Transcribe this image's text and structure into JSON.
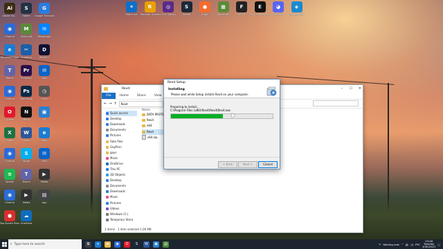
{
  "desktop": {
    "left_icons": [
      {
        "label": "Adobe Illu...",
        "color": "#3b2c12",
        "glyph": "Ai",
        "icon": "illustrator-icon"
      },
      {
        "label": "Chrome",
        "color": "#2b6bd6",
        "glyph": "◉",
        "icon": "chrome-icon"
      },
      {
        "label": "Microsoft Edge",
        "color": "#1b7bd4",
        "glyph": "e",
        "icon": "edge-icon"
      },
      {
        "label": "Teams",
        "color": "#6264a7",
        "glyph": "T",
        "icon": "teams-icon"
      },
      {
        "label": "Chrome",
        "color": "#2b6bd6",
        "glyph": "◉",
        "icon": "chrome-icon"
      },
      {
        "label": "Opera",
        "color": "#e0192c",
        "glyph": "O",
        "icon": "opera-icon"
      },
      {
        "label": "Excel",
        "color": "#1e7145",
        "glyph": "X",
        "icon": "excel-icon"
      },
      {
        "label": "Chrome",
        "color": "#2b6bd6",
        "glyph": "◉",
        "icon": "chrome-icon"
      },
      {
        "label": "Spotify",
        "color": "#1db954",
        "glyph": "≋",
        "icon": "spotify-icon"
      },
      {
        "label": "Chrome",
        "color": "#2b6bd6",
        "glyph": "◉",
        "icon": "chrome-icon"
      },
      {
        "label": "Top Screen Recorder",
        "color": "#d83030",
        "glyph": "●",
        "icon": "recorder-icon"
      }
    ],
    "col2_icons": [
      {
        "label": "Steam",
        "color": "#234",
        "glyph": "S",
        "icon": "steam-icon"
      },
      {
        "label": "Minecraft",
        "color": "#5a8a3a",
        "glyph": "M",
        "icon": "minecraft-icon"
      },
      {
        "label": "Snipping",
        "color": "#1a5fa8",
        "glyph": "✂",
        "icon": "snip-icon"
      },
      {
        "label": "Premiere",
        "color": "#2a0f4a",
        "glyph": "Pr",
        "icon": "premiere-icon"
      },
      {
        "label": "Photoshop",
        "color": "#0a2a45",
        "glyph": "Ps",
        "icon": "photoshop-icon"
      },
      {
        "label": "Netflix",
        "color": "#111",
        "glyph": "N",
        "icon": "netflix-icon"
      },
      {
        "label": "Word",
        "color": "#2b579a",
        "glyph": "W",
        "icon": "word-icon"
      },
      {
        "label": "Skype",
        "color": "#00aff0",
        "glyph": "S",
        "icon": "skype-icon"
      },
      {
        "label": "Teams",
        "color": "#6264a7",
        "glyph": "T",
        "icon": "teams-icon"
      },
      {
        "label": "Media",
        "color": "#333",
        "glyph": "▶",
        "icon": "media-icon"
      },
      {
        "label": "OneDrive",
        "color": "#0f6cbd",
        "glyph": "☁",
        "icon": "onedrive-icon"
      }
    ],
    "col3_icons": [
      {
        "label": "Google Translate",
        "color": "#2a7de1",
        "glyph": "G",
        "icon": "translate-icon"
      },
      {
        "label": "Messenger",
        "color": "#0084ff",
        "glyph": "✉",
        "icon": "messenger-icon"
      },
      {
        "label": "Disney+",
        "color": "#113",
        "glyph": "D",
        "icon": "disney-icon"
      },
      {
        "label": "Mail",
        "color": "#0a64c8",
        "glyph": "✉",
        "icon": "mail-icon"
      },
      {
        "label": "Clock",
        "color": "#555",
        "glyph": "◷",
        "icon": "clock-icon"
      },
      {
        "label": "3D",
        "color": "#2a80d0",
        "glyph": "▣",
        "icon": "3d-icon"
      },
      {
        "label": "Edge",
        "color": "#1b7bd4",
        "glyph": "e",
        "icon": "edge-icon"
      },
      {
        "label": "Mail",
        "color": "#0a64c8",
        "glyph": "✉",
        "icon": "mail-icon"
      },
      {
        "label": "Media",
        "color": "#333",
        "glyph": "▶",
        "icon": "media-icon"
      },
      {
        "label": "App",
        "color": "#444",
        "glyph": "▤",
        "icon": "app-icon"
      }
    ],
    "top_icons": [
      {
        "label": "Battle.net",
        "color": "#0e6fc8",
        "glyph": "✶",
        "icon": "battlenet-icon"
      },
      {
        "label": "Rockstar Games",
        "color": "#e8a000",
        "glyph": "R",
        "icon": "rockstar-icon"
      },
      {
        "label": "GOG Galaxy",
        "color": "#5a2a8a",
        "glyph": "◎",
        "icon": "gog-icon"
      },
      {
        "label": "Steam",
        "color": "#1b2838",
        "glyph": "S",
        "icon": "steam-icon"
      },
      {
        "label": "Origin",
        "color": "#f56c2d",
        "glyph": "●",
        "icon": "origin-icon"
      },
      {
        "label": "Minecraft",
        "color": "#5a8a3a",
        "glyph": "▦",
        "icon": "minecraft-icon"
      },
      {
        "label": "FACEIT",
        "color": "#222",
        "glyph": "F",
        "icon": "faceit-icon"
      },
      {
        "label": "Epic Games Launcher",
        "color": "#111",
        "glyph": "E",
        "icon": "epic-icon"
      },
      {
        "label": "Discord",
        "color": "#5865f2",
        "glyph": "◕",
        "icon": "discord-icon"
      },
      {
        "label": "GameGuard",
        "color": "#1a8ad0",
        "glyph": "◈",
        "icon": "gameguard-icon"
      }
    ]
  },
  "explorer": {
    "title": "Revit",
    "ribbon": [
      "File",
      "Home",
      "Share",
      "View",
      "Application Tools"
    ],
    "address": "Revit",
    "column_header": "Name",
    "nav_items": [
      {
        "label": "Quick access",
        "color": "#2c7be5",
        "sel": true
      },
      {
        "label": "Desktop",
        "color": "#2c7be5"
      },
      {
        "label": "Downloads",
        "color": "#2c7be5"
      },
      {
        "label": "Documents",
        "color": "#888"
      },
      {
        "label": "Pictures",
        "color": "#2c7be5"
      },
      {
        "label": "Fake files",
        "color": "#e8b94a"
      },
      {
        "label": "GayPorn",
        "color": "#e8b94a"
      },
      {
        "label": "gays",
        "color": "#e8b94a"
      },
      {
        "label": "Music",
        "color": "#e8508a"
      },
      {
        "label": "OneDrive",
        "color": "#0f6cbd"
      },
      {
        "label": "This PC",
        "color": "#2c7be5"
      },
      {
        "label": "3D Objects",
        "color": "#2c9ce5"
      },
      {
        "label": "Desktop",
        "color": "#2c7be5"
      },
      {
        "label": "Documents",
        "color": "#888"
      },
      {
        "label": "Downloads",
        "color": "#2c7be5"
      },
      {
        "label": "Music",
        "color": "#e8508a"
      },
      {
        "label": "Pictures",
        "color": "#2c7be5"
      },
      {
        "label": "Videos",
        "color": "#7a4fcf"
      },
      {
        "label": "Windows (C:)",
        "color": "#777"
      },
      {
        "label": "Temporary Stora",
        "color": "#777"
      }
    ],
    "files": [
      {
        "name": "DATA PROTECT",
        "type": "folder"
      },
      {
        "name": "Revit",
        "type": "folder"
      },
      {
        "name": "x64",
        "type": "folder"
      },
      {
        "name": "Revit",
        "type": "folder",
        "sel": true
      },
      {
        "name": "x64.zip",
        "type": "doc"
      }
    ],
    "status": [
      "3 items",
      "1 item selected  1.06 MB"
    ]
  },
  "setup": {
    "title": "Revit Setup",
    "heading": "Installing",
    "subheading": "Please wait while Setup installs Revit on your computer.",
    "preparing": "Preparing to install...",
    "path": "C:\\Program Files (x86)\\Revit\\Revit\\Revit.exe",
    "progress": 0.51,
    "buttons": {
      "back": "< Back",
      "next": "Next >",
      "cancel": "Cancel"
    }
  },
  "taskbar": {
    "search_placeholder": "Type here to search",
    "apps": [
      {
        "icon": "task-view-icon",
        "color": "#3a3f48",
        "glyph": "⧉"
      },
      {
        "icon": "edge-icon",
        "color": "#1b7bd4",
        "glyph": "e"
      },
      {
        "icon": "file-explorer-icon",
        "color": "#e8b94a",
        "glyph": "▬"
      },
      {
        "icon": "chrome-icon",
        "color": "#2b6bd6",
        "glyph": "◉"
      },
      {
        "icon": "opera-icon",
        "color": "#e0192c",
        "glyph": "O"
      },
      {
        "icon": "steam-icon",
        "color": "#1b2838",
        "glyph": "S"
      },
      {
        "icon": "word-icon",
        "color": "#2b579a",
        "glyph": "W"
      },
      {
        "icon": "photos-icon",
        "color": "#2a80d0",
        "glyph": "▣"
      },
      {
        "icon": "setup-icon",
        "color": "#4c8a3a",
        "glyph": "▤"
      }
    ],
    "weather": "Raining now",
    "lang": "PYC",
    "time": "23:46",
    "day": "Tuesday",
    "date": "3/30/2021"
  }
}
